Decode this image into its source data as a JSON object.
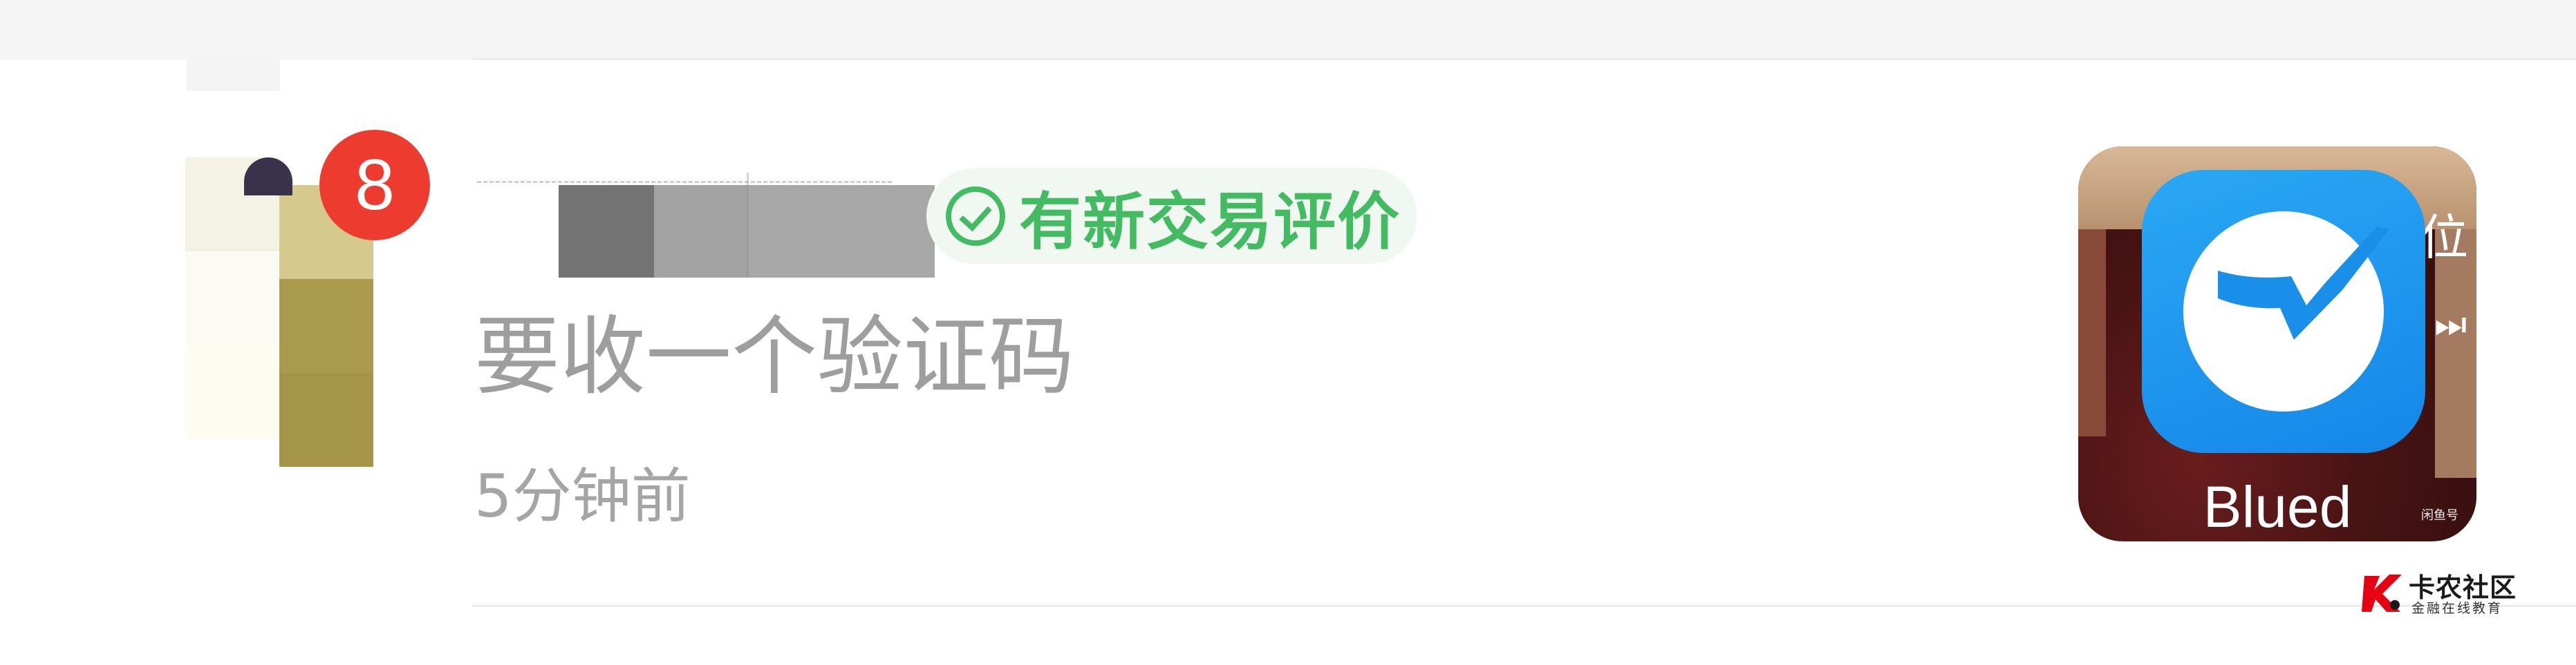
{
  "notification": {
    "badge_count": "8",
    "tag_label": "有新交易评价",
    "message": "要收一个验证码",
    "time": "5分钟前"
  },
  "thumbnail": {
    "app_name": "Blued",
    "overlay_char": "位",
    "corner_text": "闲鱼号"
  },
  "watermark": {
    "title": "卡农社区",
    "subtitle": "金融在线教育"
  },
  "colors": {
    "badge": "#ee3b30",
    "tag_green": "#43bb63",
    "tag_bg": "#f1f8f2",
    "app_blue": "#1e9cf0",
    "watermark_red": "#e60012"
  },
  "icons": [
    "check-circle-icon",
    "blued-app-icon",
    "next-track-icon",
    "kanong-logo-icon"
  ]
}
